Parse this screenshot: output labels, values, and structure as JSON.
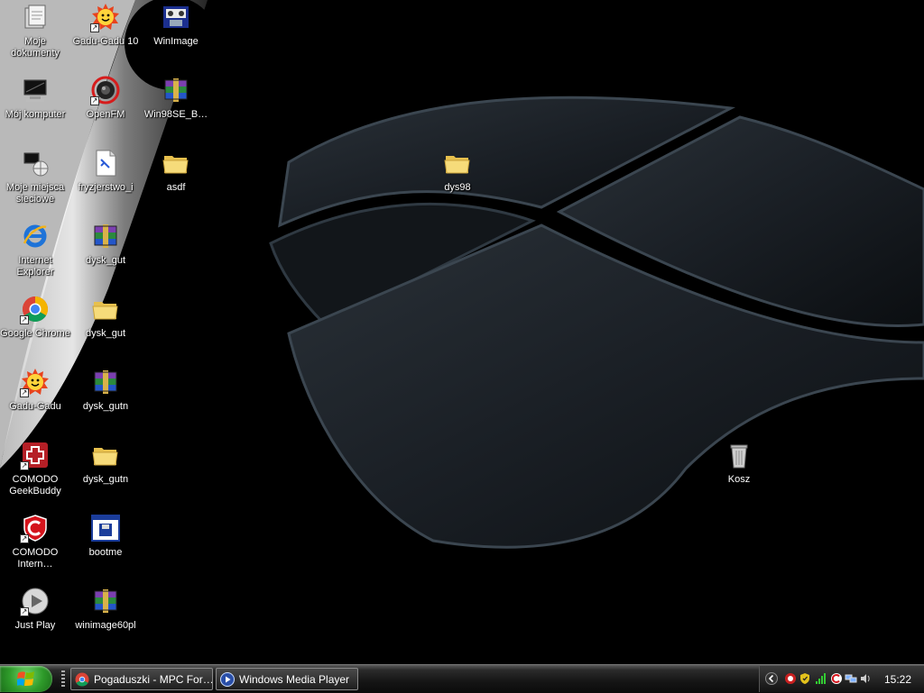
{
  "desktop": {
    "icons": [
      {
        "id": "moje-dokumenty",
        "label": "Moje dokumenty",
        "icon": "documents-icon"
      },
      {
        "id": "gadu-gadu-10",
        "label": "Gadu-Gadu 10",
        "icon": "gadu-gadu-icon"
      },
      {
        "id": "winimage",
        "label": "WinImage",
        "icon": "winimage-icon"
      },
      {
        "id": "moj-komputer",
        "label": "Mój komputer",
        "icon": "computer-icon"
      },
      {
        "id": "openfm",
        "label": "OpenFM",
        "icon": "openfm-icon"
      },
      {
        "id": "win98se-b",
        "label": "Win98SE_B…",
        "icon": "winrar-archive-icon"
      },
      {
        "id": "moje-miejsca-sieciowe",
        "label": "Moje miejsca sieciowe",
        "icon": "network-places-icon"
      },
      {
        "id": "fryzjerstwo-i",
        "label": "fryzjerstwo_i",
        "icon": "document-file-icon"
      },
      {
        "id": "asdf",
        "label": "asdf",
        "icon": "folder-icon"
      },
      {
        "id": "dys98",
        "label": "dys98",
        "icon": "folder-icon"
      },
      {
        "id": "internet-explorer",
        "label": "Internet Explorer",
        "icon": "internet-explorer-icon"
      },
      {
        "id": "dysk-gut-rar",
        "label": "dysk_gut",
        "icon": "winrar-archive-icon"
      },
      {
        "id": "google-chrome",
        "label": "Google Chrome",
        "icon": "chrome-icon"
      },
      {
        "id": "dysk-gut-folder",
        "label": "dysk_gut",
        "icon": "folder-icon"
      },
      {
        "id": "gadu-gadu",
        "label": "Gadu-Gadu",
        "icon": "gadu-gadu-icon"
      },
      {
        "id": "dysk-gutn-rar",
        "label": "dysk_gutn",
        "icon": "winrar-archive-icon"
      },
      {
        "id": "comodo-geekbuddy",
        "label": "COMODO GeekBuddy",
        "icon": "geekbuddy-icon"
      },
      {
        "id": "dysk-gutn-folder",
        "label": "dysk_gutn",
        "icon": "folder-icon"
      },
      {
        "id": "comodo-internet",
        "label": "COMODO Intern…",
        "icon": "comodo-shield-icon"
      },
      {
        "id": "bootme",
        "label": "bootme",
        "icon": "floppy-window-icon"
      },
      {
        "id": "just-play",
        "label": "Just Play",
        "icon": "play-icon"
      },
      {
        "id": "winimage60pl",
        "label": "winimage60pl",
        "icon": "winrar-archive-icon"
      },
      {
        "id": "kosz",
        "label": "Kosz",
        "icon": "recycle-bin-icon"
      }
    ]
  },
  "taskbar": {
    "tasks": [
      {
        "label": "Pogaduszki - MPC For…",
        "icon": "chrome-icon"
      },
      {
        "label": "Windows Media Player",
        "icon": "media-player-icon"
      }
    ],
    "tray": {
      "clock": "15:22",
      "icons": [
        "chevron-left-icon",
        "comodo-defense-icon",
        "security-shield-icon",
        "signal-icon",
        "comodo-c-icon",
        "network-icon",
        "volume-icon"
      ]
    }
  },
  "colors": {
    "folder": "#f4d46a",
    "start_green": "#2e9a2a",
    "comodo_red": "#d4141c"
  }
}
